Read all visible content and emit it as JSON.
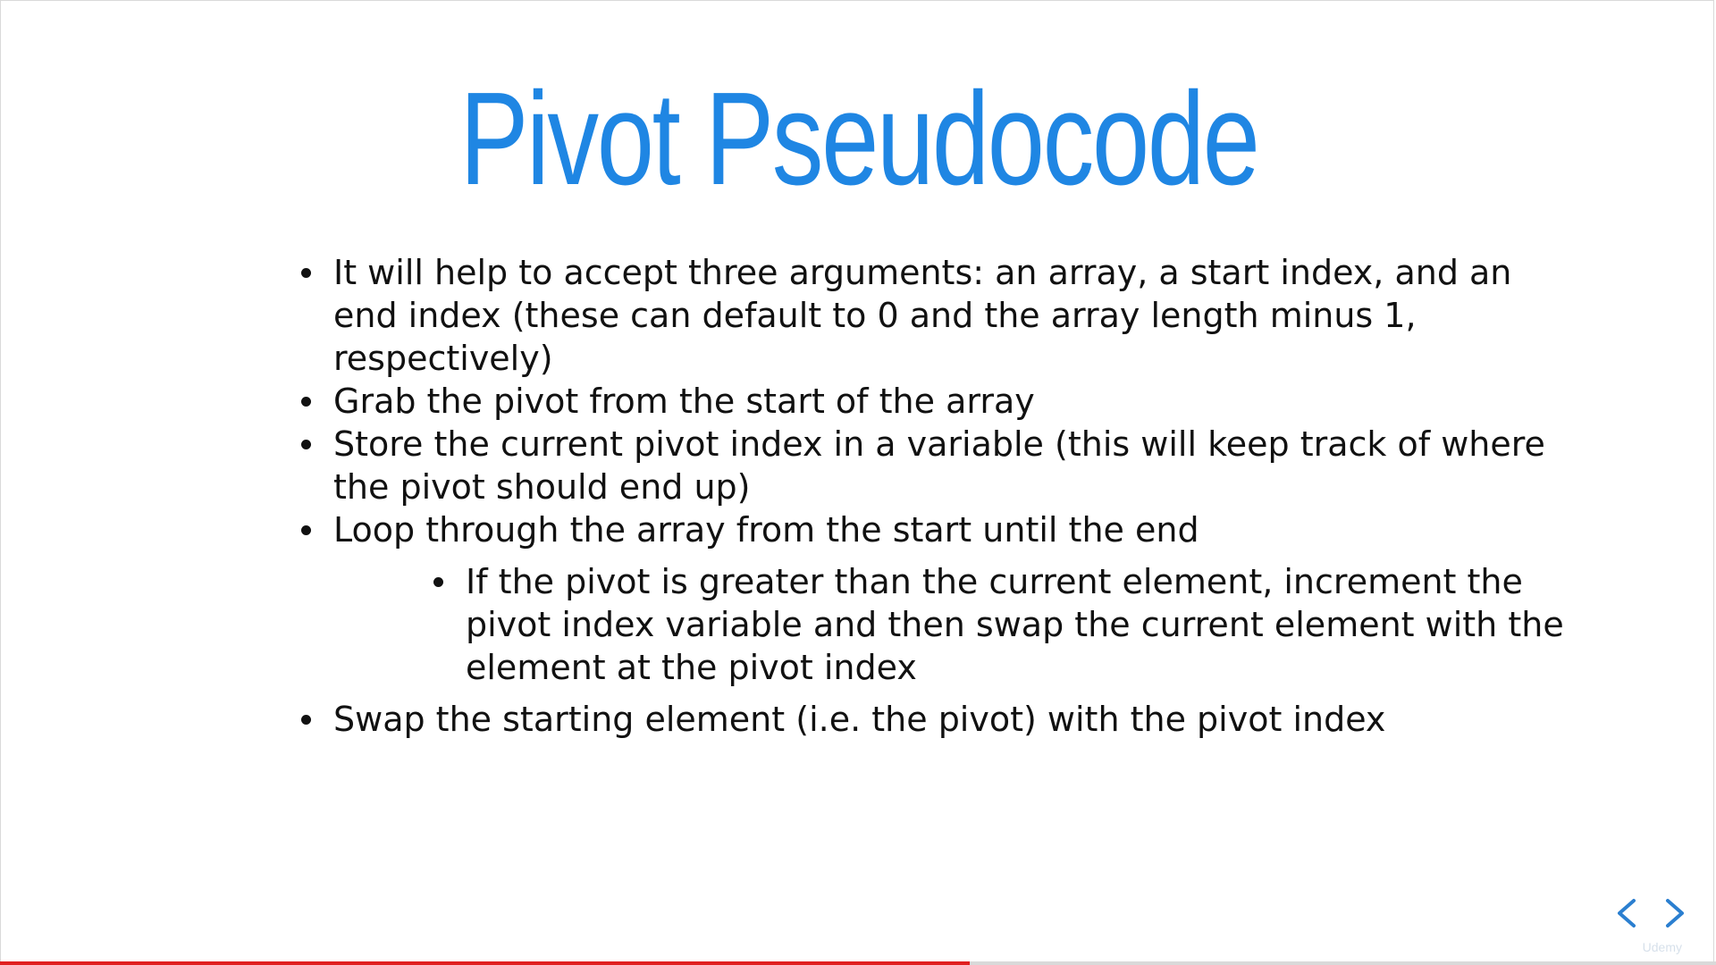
{
  "slide": {
    "title": "Pivot Pseudocode",
    "bullets": [
      "It will help to accept three arguments: an array, a start index, and an end index (these can default to 0 and the array length minus 1, respectively)",
      "Grab the pivot from the start of the array",
      "Store the current pivot index in a variable (this will keep track of where the pivot should end up)",
      "Loop through the array from the start until the end"
    ],
    "sub_bullets": [
      "If the pivot is greater than the current element, increment the pivot index variable and then swap the current element with the element at the pivot index"
    ],
    "final_bullet": "Swap the starting element (i.e. the pivot) with the pivot index"
  },
  "player": {
    "progress_fraction": 0.565,
    "progress_color": "#e02020",
    "brand": "Udemy",
    "nav_prev_icon": "chevron-left-icon",
    "nav_next_icon": "chevron-right-icon"
  },
  "colors": {
    "title": "#1f86e3",
    "text": "#111111",
    "background": "#ffffff"
  }
}
